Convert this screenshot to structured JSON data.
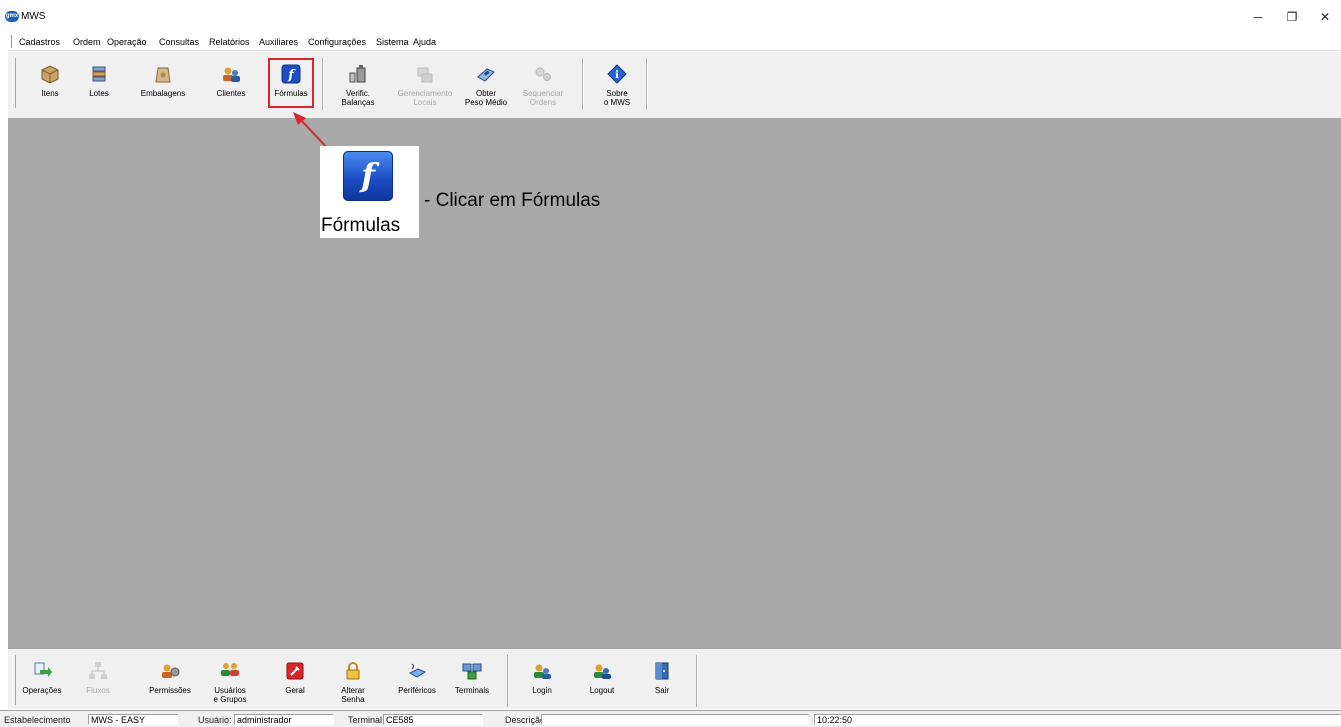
{
  "window": {
    "title": "MWS",
    "logo_text": "gmx"
  },
  "window_controls": {
    "minimize": "─",
    "maximize": "❐",
    "close": "✕"
  },
  "menu": [
    "Cadastros",
    "Ordem",
    "Operação",
    "Consultas",
    "Relatórios",
    "Auxiliares",
    "Configurações",
    "Sistema",
    "Ajuda"
  ],
  "toolbar": {
    "itens": "Itens",
    "lotes": "Lotes",
    "embalagens": "Embalagens",
    "clientes": "Clientes",
    "formulas": "Fórmulas",
    "verific_balancas": "Verific.\nBalanças",
    "gerenciamento_locais": "Gerenciamento\nLocais",
    "obter_peso_medio": "Obter\nPeso Médio",
    "sequenciar_ordens": "Sequenciar\nOrdens",
    "sobre_mws": "Sobre\no MWS"
  },
  "callout": {
    "icon_letter": "f",
    "icon_label": "Fórmulas",
    "text": "-  Clicar em Fórmulas"
  },
  "bottom_toolbar": {
    "operacoes": "Operações",
    "fluxos": "Fluxos",
    "permissoes": "Permissões",
    "usuarios_grupos": "Usuários\ne Grupos",
    "geral": "Geral",
    "alterar_senha": "Alterar\nSenha",
    "perifericos": "Periféricos",
    "terminais": "Terminais",
    "login": "Login",
    "logout": "Logout",
    "sair": "Sair"
  },
  "status": {
    "estabelecimento_label": "Estabelecimento",
    "estabelecimento_value": "MWS - EASY",
    "usuario_label": "Usuário:",
    "usuario_value": "administrador",
    "terminal_label": "Terminal",
    "terminal_value": "CE585",
    "descricao_label": "Descrição",
    "descricao_value": "",
    "time": "10:22:50"
  },
  "colors": {
    "workspace": "#a9a9a9",
    "highlight": "#d8262b",
    "formula_icon": "#1c4fc4"
  }
}
